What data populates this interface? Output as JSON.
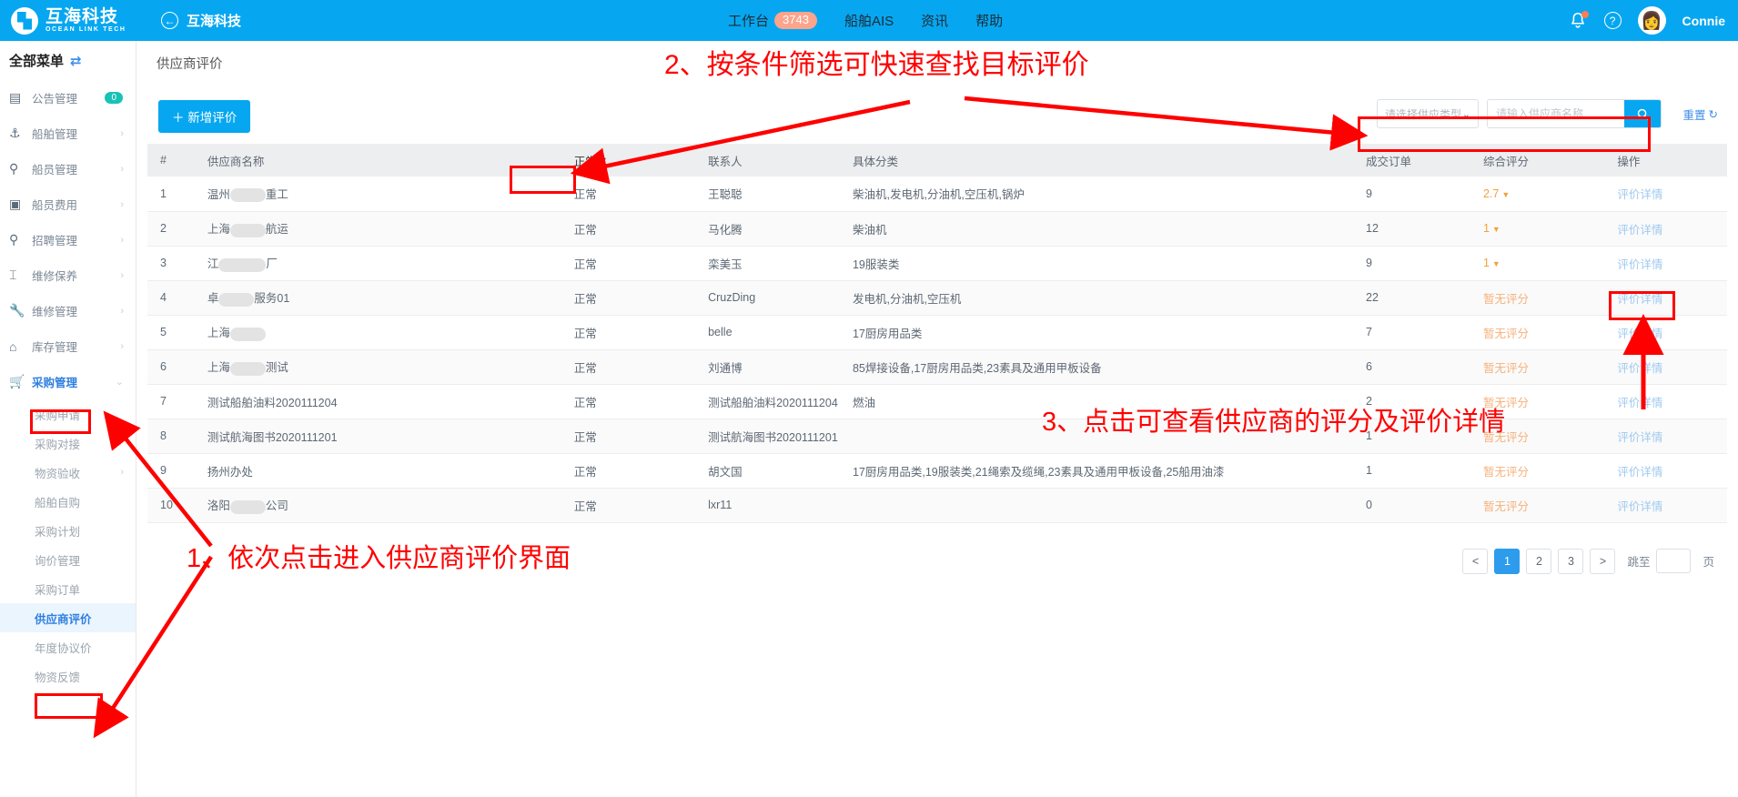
{
  "topbar": {
    "logo_cn": "互海科技",
    "logo_en": "OCEAN LINK TECH",
    "back_label": "互海科技",
    "nav": [
      {
        "label": "工作台",
        "badge": "3743"
      },
      {
        "label": "船舶AIS",
        "badge": ""
      },
      {
        "label": "资讯",
        "badge": ""
      },
      {
        "label": "帮助",
        "badge": ""
      }
    ],
    "username": "Connie",
    "bell_icon": "bell-icon",
    "help_icon": "question-circle-icon",
    "avatar_icon": "user-avatar"
  },
  "sidebar": {
    "title": "全部菜单",
    "swap_icon": "⇄",
    "items": [
      {
        "icon": "announcement-icon",
        "label": "公告管理",
        "badge": "0",
        "chevron": ""
      },
      {
        "icon": "anchor-icon",
        "label": "船舶管理",
        "badge": "",
        "chevron": "›"
      },
      {
        "icon": "crew-icon",
        "label": "船员管理",
        "badge": "",
        "chevron": "›"
      },
      {
        "icon": "expense-icon",
        "label": "船员费用",
        "badge": "",
        "chevron": "›"
      },
      {
        "icon": "recruit-icon",
        "label": "招聘管理",
        "badge": "",
        "chevron": "›"
      },
      {
        "icon": "maintenance-icon",
        "label": "维修保养",
        "badge": "",
        "chevron": "›"
      },
      {
        "icon": "wrench-icon",
        "label": "维修管理",
        "badge": "",
        "chevron": "›"
      },
      {
        "icon": "warehouse-icon",
        "label": "库存管理",
        "badge": "",
        "chevron": "›"
      },
      {
        "icon": "cart-icon",
        "label": "采购管理",
        "badge": "",
        "chevron": "⌄",
        "active": true
      }
    ],
    "submenu": [
      {
        "label": "采购申请",
        "chevron": ""
      },
      {
        "label": "采购对接",
        "chevron": ""
      },
      {
        "label": "物资验收",
        "chevron": "›"
      },
      {
        "label": "船舶自购",
        "chevron": ""
      },
      {
        "label": "采购计划",
        "chevron": ""
      },
      {
        "label": "询价管理",
        "chevron": ""
      },
      {
        "label": "采购订单",
        "chevron": ""
      },
      {
        "label": "供应商评价",
        "chevron": "",
        "selected": true
      },
      {
        "label": "年度协议价",
        "chevron": ""
      },
      {
        "label": "物资反馈",
        "chevron": ""
      }
    ]
  },
  "main": {
    "page_title": "供应商评价",
    "add_button": "＋ 新增评价",
    "filter": {
      "type_placeholder": "请选择供应类型",
      "search_placeholder": "请输入供应商名称",
      "search_value": "",
      "search_icon": "search-icon",
      "reset_label": "重置",
      "reset_icon": "refresh-icon",
      "chevron_icon": "chevron-down-icon"
    },
    "table": {
      "headers": [
        "#",
        "供应商名称",
        "正常",
        "联系人",
        "具体分类",
        "成交订单",
        "综合评分",
        "操作"
      ],
      "status_filter_label": "正常",
      "rows": [
        {
          "idx": "1",
          "name": "温州▮▮▮重工",
          "name_redact": true,
          "status": "正常",
          "contact": "王聪聪",
          "category": "柴油机,发电机,分油机,空压机,锅炉",
          "orders": "9",
          "score": "2.7",
          "score_none": "",
          "op": "评价详情"
        },
        {
          "idx": "2",
          "name": "上海▮▮▮航运",
          "name_redact": true,
          "status": "正常",
          "contact": "马化腾",
          "category": "柴油机",
          "orders": "12",
          "score": "1",
          "score_none": "",
          "op": "评价详情"
        },
        {
          "idx": "3",
          "name": "江▮▮▮▮厂",
          "name_redact": true,
          "status": "正常",
          "contact": "栾美玉",
          "category": "19服装类",
          "orders": "9",
          "score": "1",
          "score_none": "",
          "op": "评价详情"
        },
        {
          "idx": "4",
          "name": "卓▮▮▮服务01",
          "name_redact": true,
          "status": "正常",
          "contact": "CruzDing",
          "category": "发电机,分油机,空压机",
          "orders": "22",
          "score": "",
          "score_none": "暂无评分",
          "op": "评价详情"
        },
        {
          "idx": "5",
          "name": "上海▮▮▮",
          "name_redact": true,
          "status": "正常",
          "contact": "belle",
          "category": "17厨房用品类",
          "orders": "7",
          "score": "",
          "score_none": "暂无评分",
          "op": "评价详情"
        },
        {
          "idx": "6",
          "name": "上海▮▮▮测试",
          "name_redact": true,
          "status": "正常",
          "contact": "刘通博",
          "category": "85焊接设备,17厨房用品类,23素具及通用甲板设备",
          "orders": "6",
          "score": "",
          "score_none": "暂无评分",
          "op": "评价详情"
        },
        {
          "idx": "7",
          "name": "测试船舶油料2020111204",
          "name_redact": false,
          "status": "正常",
          "contact": "测试船舶油料2020111204",
          "category": "燃油",
          "orders": "2",
          "score": "",
          "score_none": "暂无评分",
          "op": "评价详情"
        },
        {
          "idx": "8",
          "name": "测试航海图书2020111201",
          "name_redact": false,
          "status": "正常",
          "contact": "测试航海图书2020111201",
          "category": "",
          "orders": "1",
          "score": "",
          "score_none": "暂无评分",
          "op": "评价详情"
        },
        {
          "idx": "9",
          "name": "扬州办处",
          "name_redact": false,
          "status": "正常",
          "contact": "胡文国",
          "category": "17厨房用品类,19服装类,21绳索及缆绳,23素具及通用甲板设备,25船用油漆",
          "orders": "1",
          "score": "",
          "score_none": "暂无评分",
          "op": "评价详情"
        },
        {
          "idx": "10",
          "name": "洛阳▮▮▮公司",
          "name_redact": true,
          "status": "正常",
          "contact": "lxr11",
          "category": "",
          "orders": "0",
          "score": "",
          "score_none": "暂无评分",
          "op": "评价详情"
        }
      ]
    },
    "pagination": {
      "prev": "<",
      "pages": [
        "1",
        "2",
        "3"
      ],
      "current": "1",
      "next": ">",
      "jump_label": "跳至",
      "jump_value": "",
      "page_unit": "页"
    }
  },
  "annotations": [
    {
      "id": "anno-1",
      "text": "1、依次点击进入供应商评价界面"
    },
    {
      "id": "anno-2",
      "text": "2、按条件筛选可快速查找目标评价"
    },
    {
      "id": "anno-3",
      "text": "3、点击可查看供应商的评分及评价详情"
    }
  ],
  "colors": {
    "brand_blue": "#06A7F0",
    "accent_link": "#3E8EEA",
    "annotation_red": "#FF0000",
    "score_orange": "#F0A33A",
    "badge_teal": "#18C2B4",
    "badge_peach": "#FCA48C"
  }
}
